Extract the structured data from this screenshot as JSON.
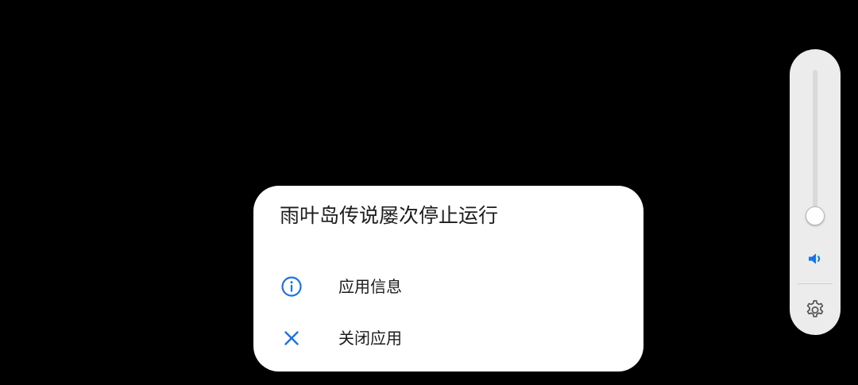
{
  "dialog": {
    "title": "雨叶岛传说屡次停止运行",
    "options": [
      {
        "label": "应用信息",
        "icon": "info-icon"
      },
      {
        "label": "关闭应用",
        "icon": "close-icon"
      }
    ]
  },
  "volume_panel": {
    "level": 0.0,
    "speaker_icon": "speaker-icon",
    "settings_icon": "gear-icon"
  },
  "colors": {
    "background": "#000000",
    "dialog_bg": "#ffffff",
    "panel_bg": "#ececec",
    "accent": "#1a73e8",
    "text": "#1c1c1c"
  }
}
